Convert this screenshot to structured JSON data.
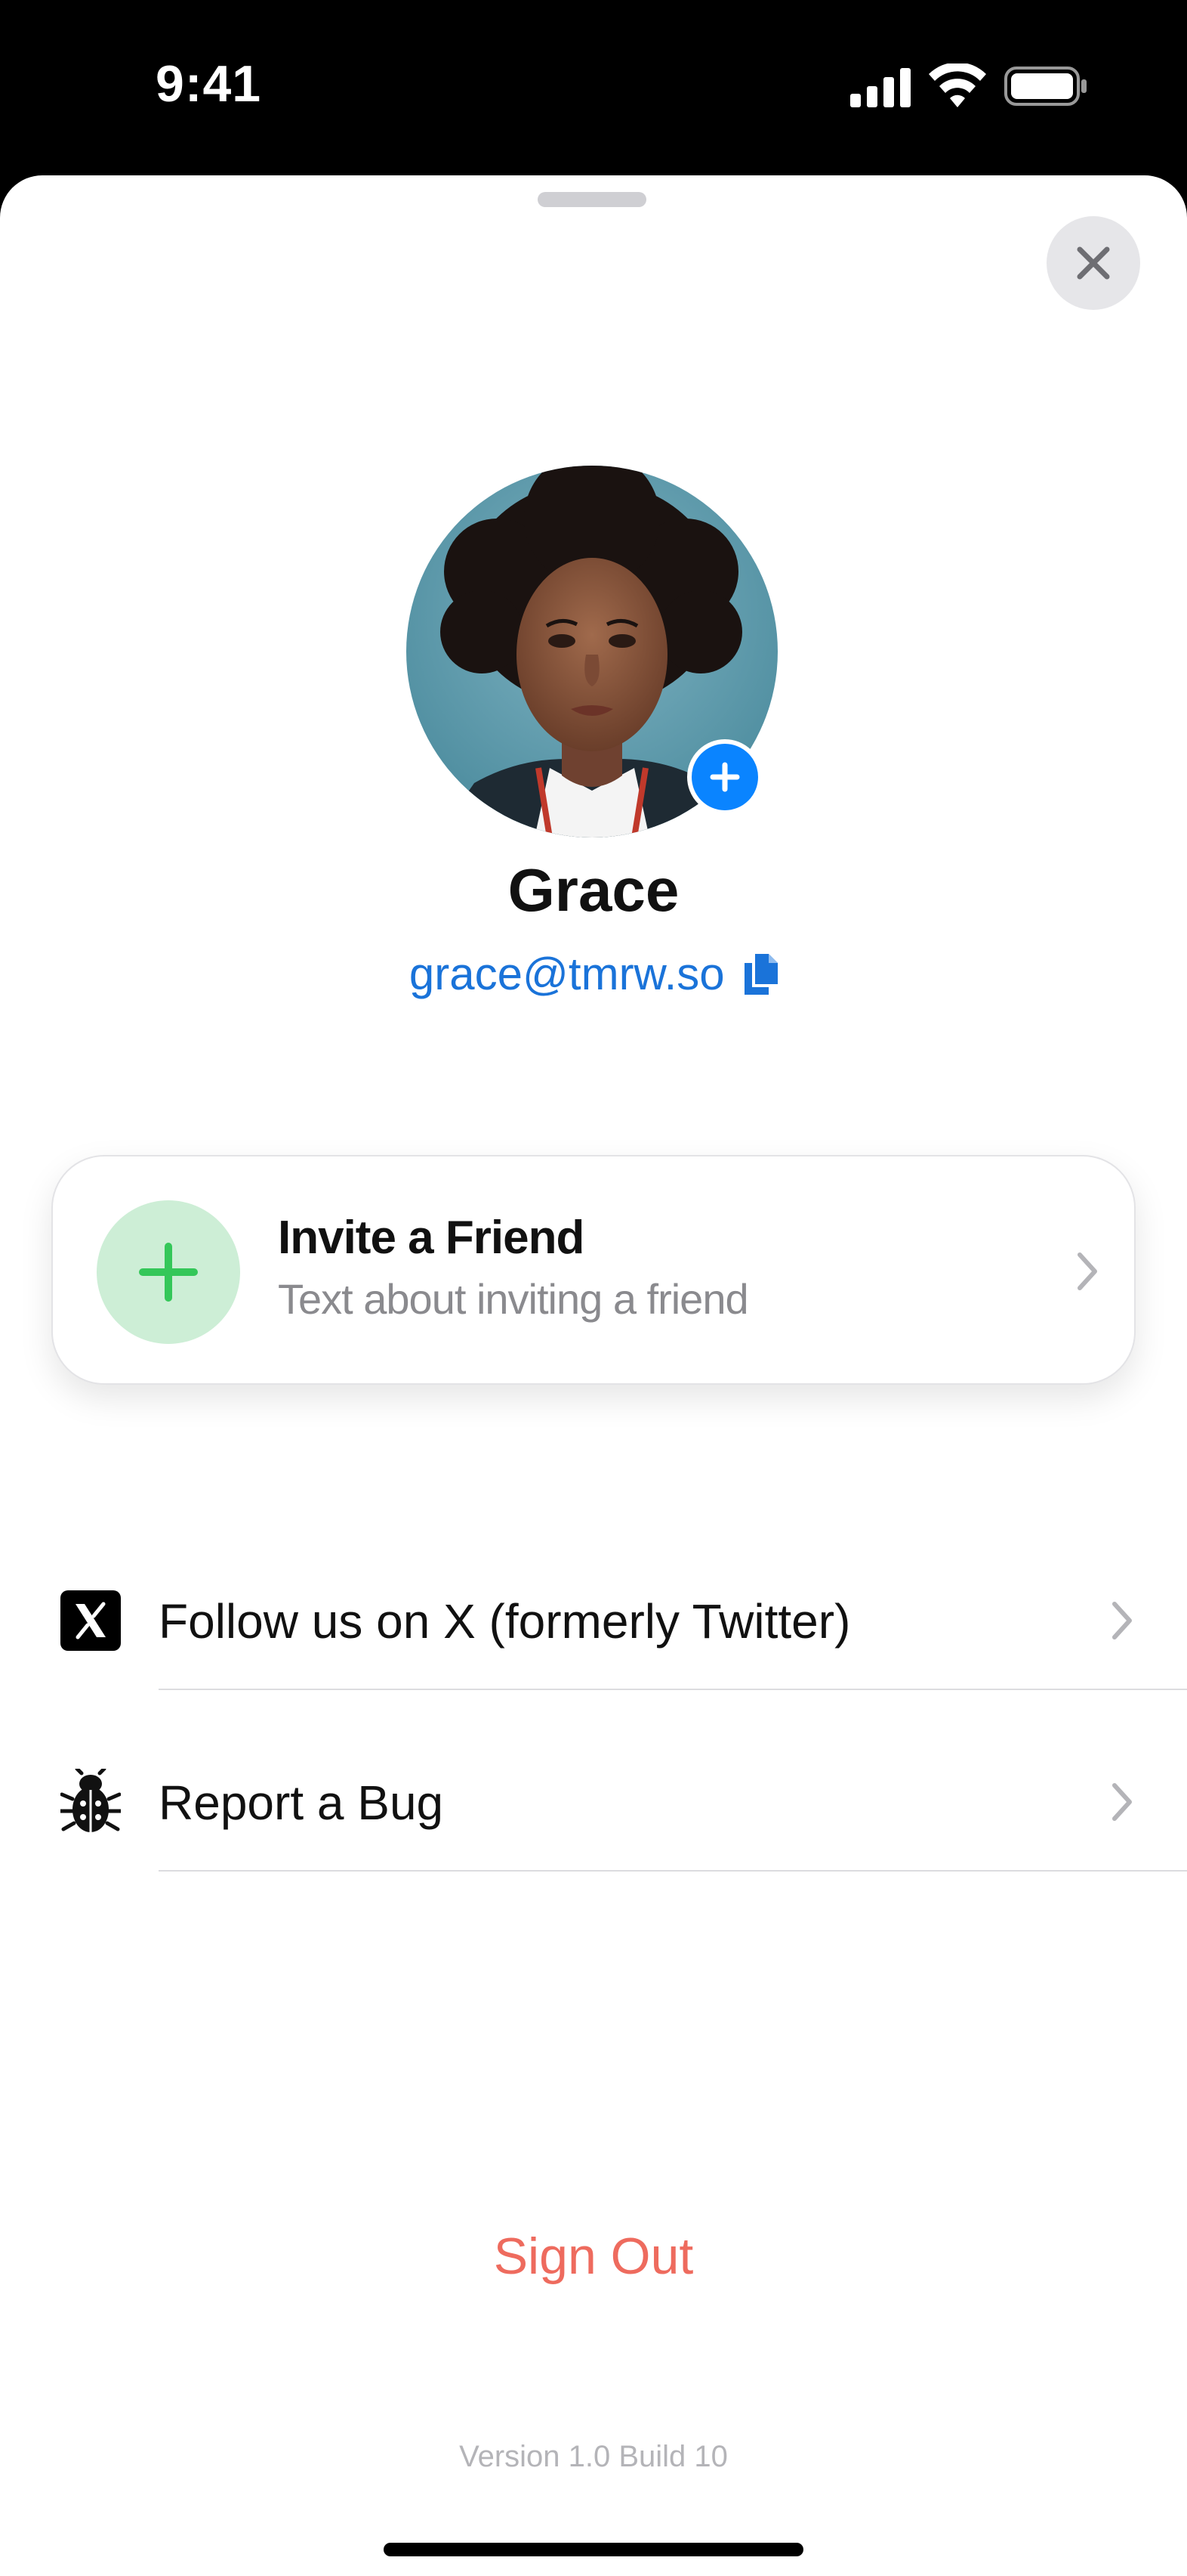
{
  "status_bar": {
    "time": "9:41"
  },
  "profile": {
    "name": "Grace",
    "email": "grace@tmrw.so"
  },
  "invite_card": {
    "title": "Invite a Friend",
    "subtitle": "Text about inviting a friend"
  },
  "menu": {
    "items": [
      {
        "label": "Follow us on X (formerly Twitter)",
        "icon": "x-logo-icon"
      },
      {
        "label": "Report a Bug",
        "icon": "bug-icon"
      }
    ]
  },
  "footer": {
    "sign_out_label": "Sign Out",
    "version": "Version 1.0 Build 10"
  },
  "colors": {
    "accent_blue": "#0a84ff",
    "link_blue": "#1a73d9",
    "invite_green": "#34c759",
    "invite_green_bg": "#cdeed6",
    "sign_out_red": "#ee6b5e"
  }
}
